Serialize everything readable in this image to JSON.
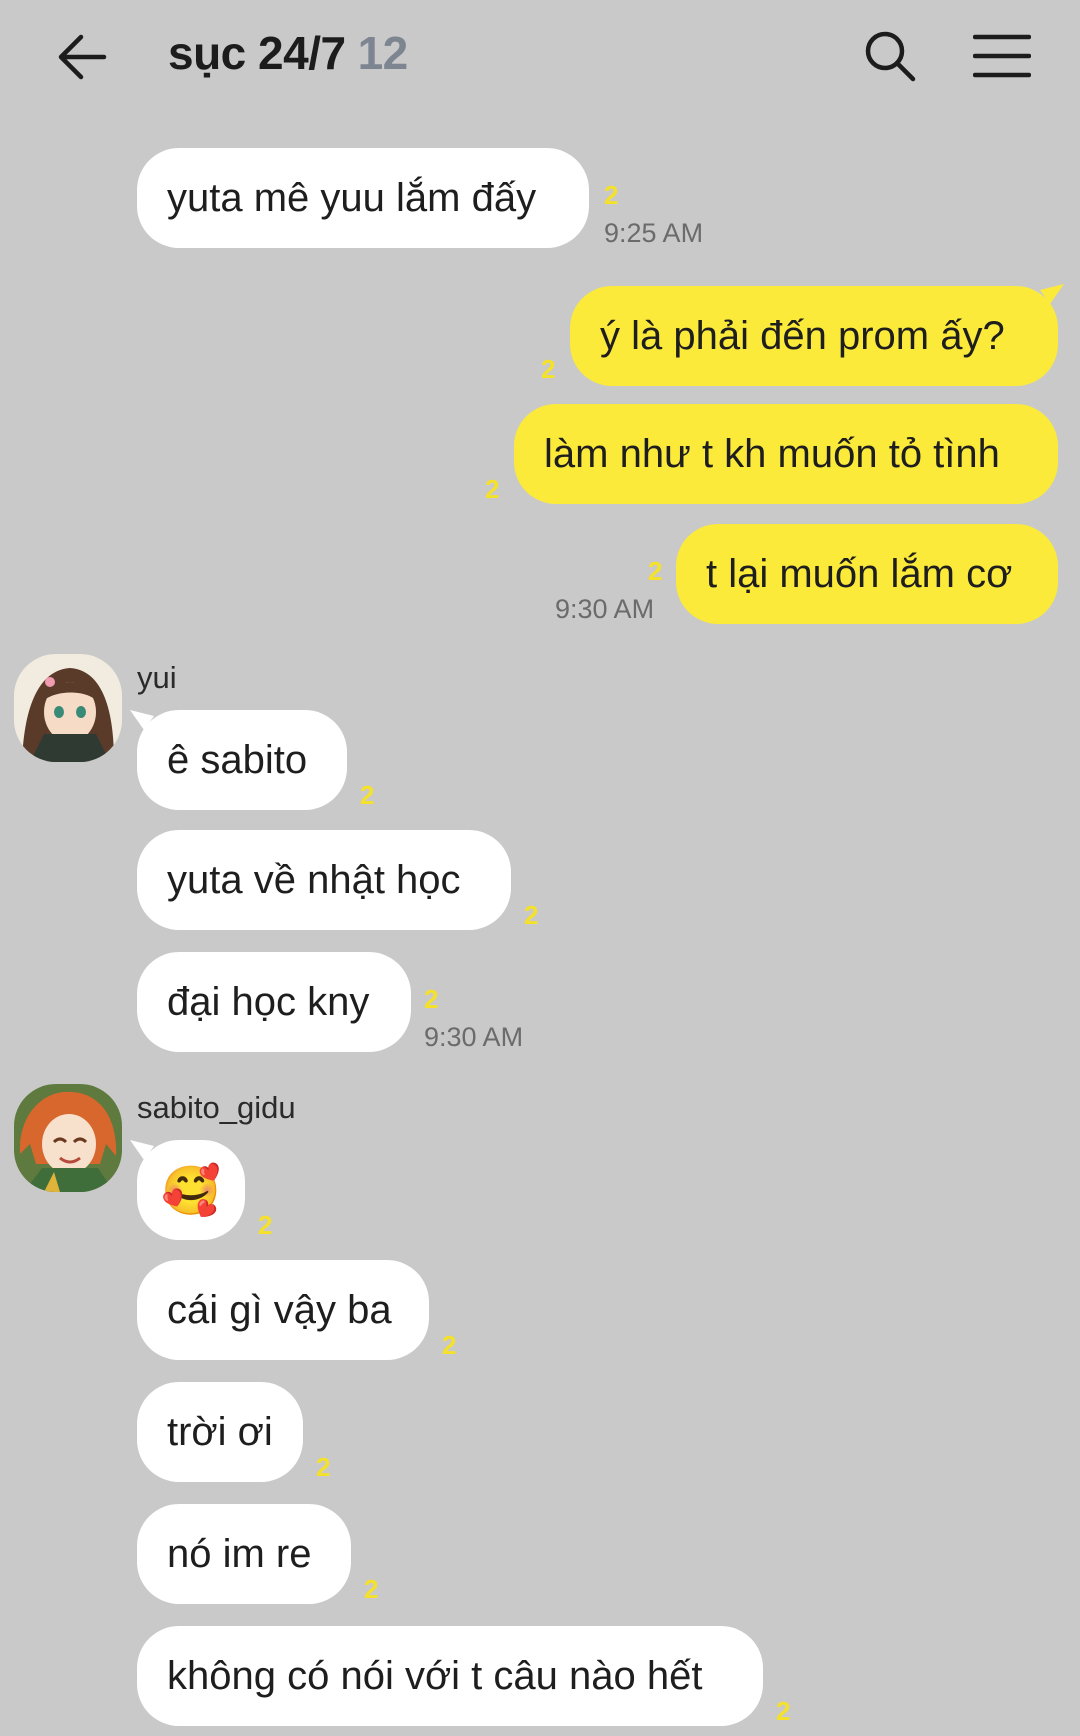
{
  "header": {
    "title": "sục 24/7",
    "member_count": "12",
    "back_icon": "arrow-left-icon",
    "search_icon": "search-icon",
    "menu_icon": "hamburger-menu-icon"
  },
  "colors": {
    "background": "#c9c9c9",
    "incoming_bubble": "#ffffff",
    "outgoing_bubble": "#fcea3b",
    "unread_count": "#f5e12a",
    "time_text": "#6b6b6b"
  },
  "messages": [
    {
      "text": "yuta mê yuu lắm đấy",
      "unread": "2",
      "time": "9:25 AM"
    },
    {
      "text": "ý là phải đến prom ấy?",
      "unread": "2"
    },
    {
      "text": "làm như t kh muốn tỏ tình",
      "unread": "2"
    },
    {
      "text": "t lại muốn lắm cơ",
      "unread": "2",
      "time": "9:30 AM"
    },
    {
      "sender": "yui",
      "text": "ê sabito",
      "unread": "2"
    },
    {
      "text": "yuta về nhật học",
      "unread": "2"
    },
    {
      "text": "đại học kny",
      "unread": "2",
      "time": "9:30 AM"
    },
    {
      "sender": "sabito_gidu",
      "text": "🥰",
      "unread": "2"
    },
    {
      "text": "cái gì vậy ba",
      "unread": "2"
    },
    {
      "text": "trời ơi",
      "unread": "2"
    },
    {
      "text": "nó im re",
      "unread": "2"
    },
    {
      "text": "không có nói với t câu nào hết",
      "unread": "2"
    }
  ]
}
